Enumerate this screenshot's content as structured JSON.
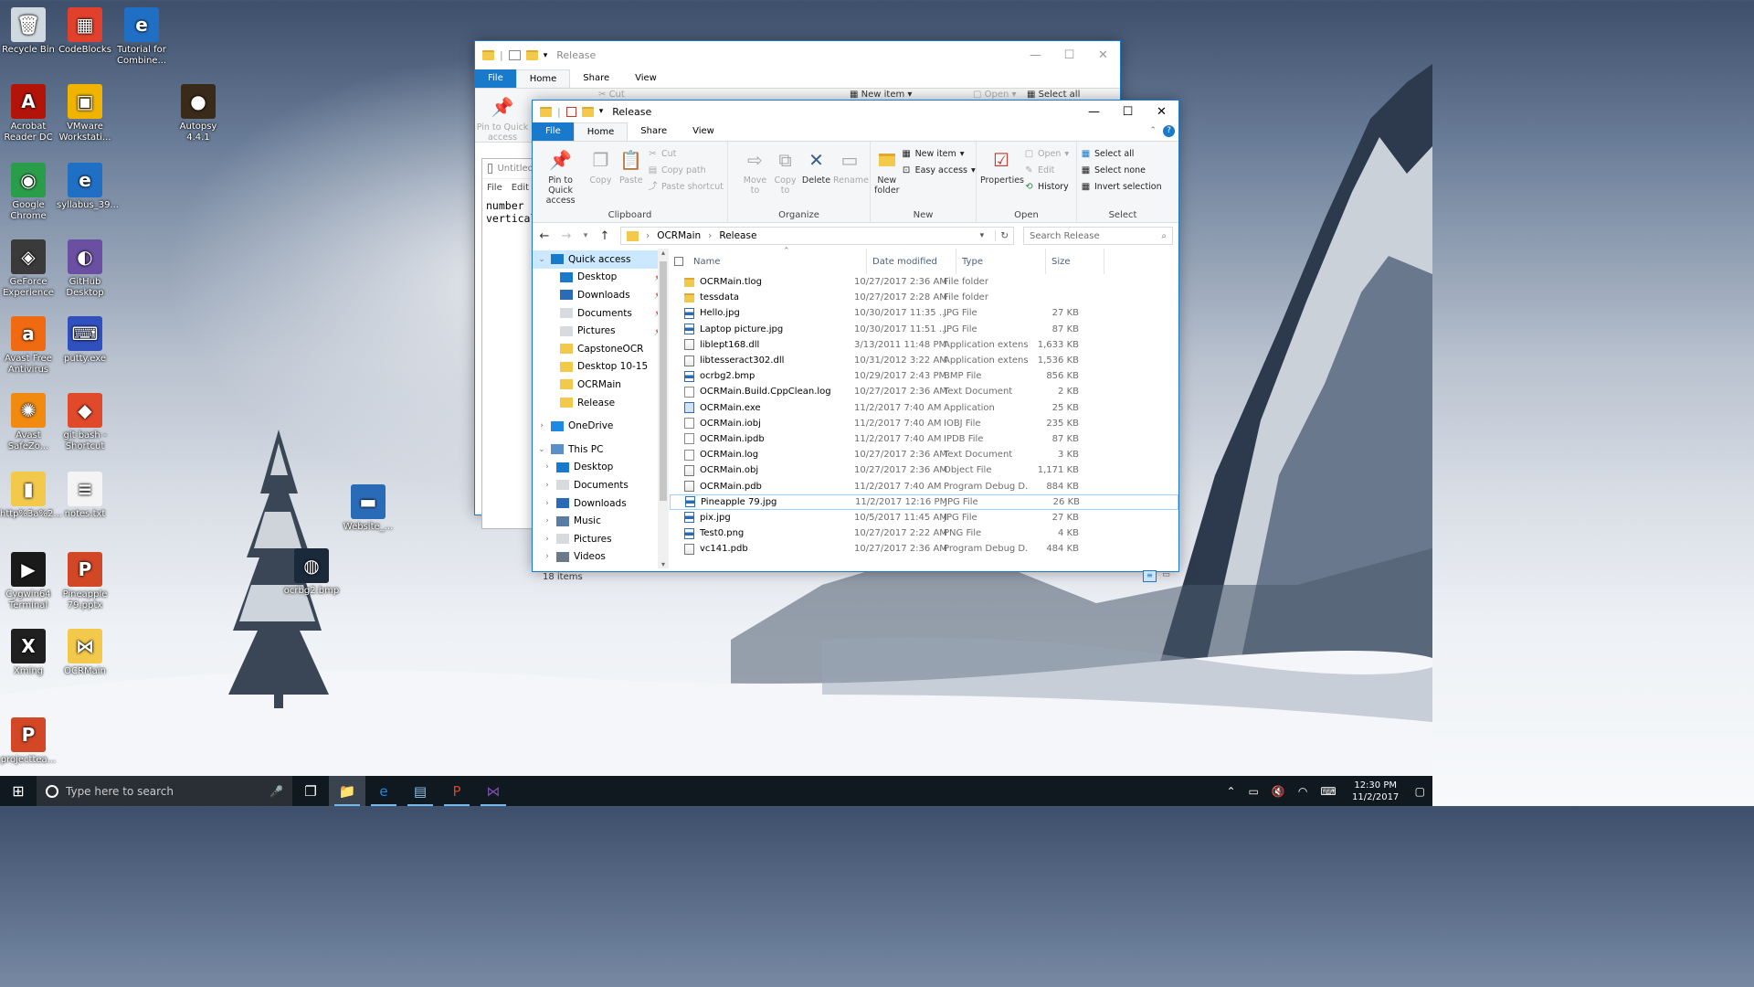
{
  "desktop": {
    "icons": [
      {
        "label": "Recycle Bin",
        "icon": "recycle-bin-icon",
        "color": "#d0d8e0"
      },
      {
        "label": "CodeBlocks",
        "icon": "codeblocks-icon",
        "color": "#e0402c"
      },
      {
        "label": "Tutorial for Combine...",
        "icon": "pdf-icon",
        "color": "#1f6fc4"
      },
      {
        "label": "Acrobat Reader DC",
        "icon": "acrobat-icon",
        "color": "#b3140a"
      },
      {
        "label": "VMware Workstati...",
        "icon": "vmware-icon",
        "color": "#f0b400"
      },
      {
        "label": "Autopsy 4.4.1",
        "icon": "autopsy-icon",
        "color": "#3a2a1a"
      },
      {
        "label": "Google Chrome",
        "icon": "chrome-icon",
        "color": "#2a9d4a"
      },
      {
        "label": "syllabus_39...",
        "icon": "pdf-icon",
        "color": "#1f6fc4"
      },
      {
        "label": "GeForce Experience",
        "icon": "geforce-icon",
        "color": "#3a3a3a"
      },
      {
        "label": "GitHub Desktop",
        "icon": "github-icon",
        "color": "#6a4fa3"
      },
      {
        "label": "Avast Free Antivirus",
        "icon": "avast-icon",
        "color": "#f06a11"
      },
      {
        "label": "putty.exe",
        "icon": "putty-icon",
        "color": "#3050c0"
      },
      {
        "label": "Avast SafeZo...",
        "icon": "avast-safezone-icon",
        "color": "#f08a11"
      },
      {
        "label": "git bash - Shortcut",
        "icon": "git-bash-icon",
        "color": "#e04a2a"
      },
      {
        "label": "http%3a%2...",
        "icon": "zip-folder-icon",
        "color": "#f3c94b"
      },
      {
        "label": "notes.txt",
        "icon": "text-file-icon",
        "color": "#f4f4f4"
      },
      {
        "label": "Website_...",
        "icon": "website-icon",
        "color": "#2a6bb8"
      },
      {
        "label": "Cygwin64 Terminal",
        "icon": "cygwin-icon",
        "color": "#1a1a1a"
      },
      {
        "label": "Pineapple 79.pptx",
        "icon": "pptx-icon",
        "color": "#d24726"
      },
      {
        "label": "ocrbg2.bmp",
        "icon": "bmp-image-icon",
        "color": "#1a2a3a"
      },
      {
        "label": "Xming",
        "icon": "xming-icon",
        "color": "#202020"
      },
      {
        "label": "OCRMain",
        "icon": "vs-project-icon",
        "color": "#f3c94b"
      },
      {
        "label": "projecttea...",
        "icon": "pptx-icon",
        "color": "#d24726"
      }
    ]
  },
  "back_window": {
    "title": "Release",
    "tabs": [
      "File",
      "Home",
      "Share",
      "View"
    ],
    "ribbon": {
      "pin_label": "Pin to Quick access",
      "cut": "Cut",
      "new_item": "New item",
      "open": "Open",
      "select_all": "Select all"
    },
    "notepad": {
      "title": "Untitled",
      "menu": [
        "File",
        "Edit"
      ],
      "lines": [
        "number",
        "vertical"
      ]
    }
  },
  "explorer": {
    "title": "Release",
    "tabs": [
      "File",
      "Home",
      "Share",
      "View"
    ],
    "ribbon": {
      "clipboard": {
        "label": "Clipboard",
        "pin": "Pin to Quick access",
        "copy": "Copy",
        "paste": "Paste",
        "cut": "Cut",
        "copy_path": "Copy path",
        "paste_shortcut": "Paste shortcut"
      },
      "organize": {
        "label": "Organize",
        "move_to": "Move to",
        "copy_to": "Copy to",
        "delete": "Delete",
        "rename": "Rename"
      },
      "new": {
        "label": "New",
        "new_folder": "New folder",
        "new_item": "New item",
        "easy_access": "Easy access"
      },
      "open": {
        "label": "Open",
        "properties": "Properties",
        "open": "Open",
        "edit": "Edit",
        "history": "History"
      },
      "select": {
        "label": "Select",
        "select_all": "Select all",
        "select_none": "Select none",
        "invert": "Invert selection"
      }
    },
    "address": {
      "crumbs": [
        "OCRMain",
        "Release"
      ],
      "search_placeholder": "Search Release"
    },
    "nav": {
      "quick_access": "Quick access",
      "quick_items": [
        {
          "label": "Desktop",
          "pinned": true,
          "icon": "desktop-icon"
        },
        {
          "label": "Downloads",
          "pinned": true,
          "icon": "downloads-icon"
        },
        {
          "label": "Documents",
          "pinned": true,
          "icon": "documents-icon"
        },
        {
          "label": "Pictures",
          "pinned": true,
          "icon": "pictures-icon"
        },
        {
          "label": "CapstoneOCR",
          "pinned": false,
          "icon": "folder-icon"
        },
        {
          "label": "Desktop 10-15",
          "pinned": false,
          "icon": "folder-icon"
        },
        {
          "label": "OCRMain",
          "pinned": false,
          "icon": "folder-icon"
        },
        {
          "label": "Release",
          "pinned": false,
          "icon": "folder-icon"
        }
      ],
      "onedrive": "OneDrive",
      "this_pc": "This PC",
      "pc_items": [
        "Desktop",
        "Documents",
        "Downloads",
        "Music",
        "Pictures",
        "Videos"
      ]
    },
    "columns": {
      "name": "Name",
      "date": "Date modified",
      "type": "Type",
      "size": "Size"
    },
    "files": [
      {
        "name": "OCRMain.tlog",
        "date": "10/27/2017 2:36 AM",
        "type": "File folder",
        "size": "",
        "kind": "folder"
      },
      {
        "name": "tessdata",
        "date": "10/27/2017 2:28 AM",
        "type": "File folder",
        "size": "",
        "kind": "folder"
      },
      {
        "name": "Hello.jpg",
        "date": "10/30/2017 11:35 ...",
        "type": "JPG File",
        "size": "27 KB",
        "kind": "img"
      },
      {
        "name": "Laptop picture.jpg",
        "date": "10/30/2017 11:51 ...",
        "type": "JPG File",
        "size": "87 KB",
        "kind": "img"
      },
      {
        "name": "liblept168.dll",
        "date": "3/13/2011 11:48 PM",
        "type": "Application extens...",
        "size": "1,633 KB",
        "kind": "dll"
      },
      {
        "name": "libtesseract302.dll",
        "date": "10/31/2012 3:22 AM",
        "type": "Application extens...",
        "size": "1,536 KB",
        "kind": "dll"
      },
      {
        "name": "ocrbg2.bmp",
        "date": "10/29/2017 2:43 PM",
        "type": "BMP File",
        "size": "856 KB",
        "kind": "img"
      },
      {
        "name": "OCRMain.Build.CppClean.log",
        "date": "10/27/2017 2:36 AM",
        "type": "Text Document",
        "size": "2 KB",
        "kind": "doc"
      },
      {
        "name": "OCRMain.exe",
        "date": "11/2/2017 7:40 AM",
        "type": "Application",
        "size": "25 KB",
        "kind": "exe"
      },
      {
        "name": "OCRMain.iobj",
        "date": "11/2/2017 7:40 AM",
        "type": "IOBJ File",
        "size": "235 KB",
        "kind": "doc"
      },
      {
        "name": "OCRMain.ipdb",
        "date": "11/2/2017 7:40 AM",
        "type": "IPDB File",
        "size": "87 KB",
        "kind": "doc"
      },
      {
        "name": "OCRMain.log",
        "date": "10/27/2017 2:36 AM",
        "type": "Text Document",
        "size": "3 KB",
        "kind": "doc"
      },
      {
        "name": "OCRMain.obj",
        "date": "10/27/2017 2:36 AM",
        "type": "Object File",
        "size": "1,171 KB",
        "kind": "dll"
      },
      {
        "name": "OCRMain.pdb",
        "date": "11/2/2017 7:40 AM",
        "type": "Program Debug D...",
        "size": "884 KB",
        "kind": "dll"
      },
      {
        "name": "Pineapple 79.jpg",
        "date": "11/2/2017 12:16 PM",
        "type": "JPG File",
        "size": "26 KB",
        "kind": "img",
        "selected": true
      },
      {
        "name": "pix.jpg",
        "date": "10/5/2017 11:45 AM",
        "type": "JPG File",
        "size": "27 KB",
        "kind": "img"
      },
      {
        "name": "Test0.png",
        "date": "10/27/2017 2:22 AM",
        "type": "PNG File",
        "size": "4 KB",
        "kind": "img"
      },
      {
        "name": "vc141.pdb",
        "date": "10/27/2017 2:36 AM",
        "type": "Program Debug D...",
        "size": "484 KB",
        "kind": "dll"
      }
    ],
    "status": "18 items"
  },
  "taskbar": {
    "search_placeholder": "Type here to search",
    "apps": [
      {
        "name": "task-view",
        "glyph": "❐"
      },
      {
        "name": "file-explorer",
        "glyph": "📁",
        "active": true
      },
      {
        "name": "internet-explorer",
        "glyph": "e"
      },
      {
        "name": "notepad",
        "glyph": "▤"
      },
      {
        "name": "powerpoint",
        "glyph": "P"
      },
      {
        "name": "visual-studio",
        "glyph": "⋈"
      }
    ],
    "time": "12:30 PM",
    "date": "11/2/2017"
  }
}
